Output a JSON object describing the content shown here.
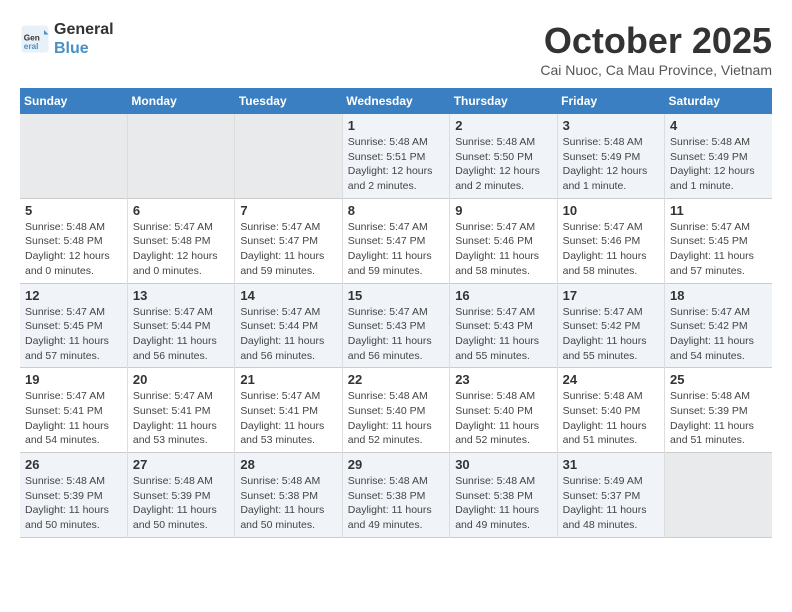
{
  "logo": {
    "line1": "General",
    "line2": "Blue"
  },
  "title": "October 2025",
  "location": "Cai Nuoc, Ca Mau Province, Vietnam",
  "days_of_week": [
    "Sunday",
    "Monday",
    "Tuesday",
    "Wednesday",
    "Thursday",
    "Friday",
    "Saturday"
  ],
  "weeks": [
    {
      "days": [
        {
          "number": "",
          "empty": true
        },
        {
          "number": "",
          "empty": true
        },
        {
          "number": "",
          "empty": true
        },
        {
          "number": "1",
          "sunrise": "5:48 AM",
          "sunset": "5:51 PM",
          "daylight": "12 hours and 2 minutes."
        },
        {
          "number": "2",
          "sunrise": "5:48 AM",
          "sunset": "5:50 PM",
          "daylight": "12 hours and 2 minutes."
        },
        {
          "number": "3",
          "sunrise": "5:48 AM",
          "sunset": "5:49 PM",
          "daylight": "12 hours and 1 minute."
        },
        {
          "number": "4",
          "sunrise": "5:48 AM",
          "sunset": "5:49 PM",
          "daylight": "12 hours and 1 minute."
        }
      ]
    },
    {
      "days": [
        {
          "number": "5",
          "sunrise": "5:48 AM",
          "sunset": "5:48 PM",
          "daylight": "12 hours and 0 minutes."
        },
        {
          "number": "6",
          "sunrise": "5:47 AM",
          "sunset": "5:48 PM",
          "daylight": "12 hours and 0 minutes."
        },
        {
          "number": "7",
          "sunrise": "5:47 AM",
          "sunset": "5:47 PM",
          "daylight": "11 hours and 59 minutes."
        },
        {
          "number": "8",
          "sunrise": "5:47 AM",
          "sunset": "5:47 PM",
          "daylight": "11 hours and 59 minutes."
        },
        {
          "number": "9",
          "sunrise": "5:47 AM",
          "sunset": "5:46 PM",
          "daylight": "11 hours and 58 minutes."
        },
        {
          "number": "10",
          "sunrise": "5:47 AM",
          "sunset": "5:46 PM",
          "daylight": "11 hours and 58 minutes."
        },
        {
          "number": "11",
          "sunrise": "5:47 AM",
          "sunset": "5:45 PM",
          "daylight": "11 hours and 57 minutes."
        }
      ]
    },
    {
      "days": [
        {
          "number": "12",
          "sunrise": "5:47 AM",
          "sunset": "5:45 PM",
          "daylight": "11 hours and 57 minutes."
        },
        {
          "number": "13",
          "sunrise": "5:47 AM",
          "sunset": "5:44 PM",
          "daylight": "11 hours and 56 minutes."
        },
        {
          "number": "14",
          "sunrise": "5:47 AM",
          "sunset": "5:44 PM",
          "daylight": "11 hours and 56 minutes."
        },
        {
          "number": "15",
          "sunrise": "5:47 AM",
          "sunset": "5:43 PM",
          "daylight": "11 hours and 56 minutes."
        },
        {
          "number": "16",
          "sunrise": "5:47 AM",
          "sunset": "5:43 PM",
          "daylight": "11 hours and 55 minutes."
        },
        {
          "number": "17",
          "sunrise": "5:47 AM",
          "sunset": "5:42 PM",
          "daylight": "11 hours and 55 minutes."
        },
        {
          "number": "18",
          "sunrise": "5:47 AM",
          "sunset": "5:42 PM",
          "daylight": "11 hours and 54 minutes."
        }
      ]
    },
    {
      "days": [
        {
          "number": "19",
          "sunrise": "5:47 AM",
          "sunset": "5:41 PM",
          "daylight": "11 hours and 54 minutes."
        },
        {
          "number": "20",
          "sunrise": "5:47 AM",
          "sunset": "5:41 PM",
          "daylight": "11 hours and 53 minutes."
        },
        {
          "number": "21",
          "sunrise": "5:47 AM",
          "sunset": "5:41 PM",
          "daylight": "11 hours and 53 minutes."
        },
        {
          "number": "22",
          "sunrise": "5:48 AM",
          "sunset": "5:40 PM",
          "daylight": "11 hours and 52 minutes."
        },
        {
          "number": "23",
          "sunrise": "5:48 AM",
          "sunset": "5:40 PM",
          "daylight": "11 hours and 52 minutes."
        },
        {
          "number": "24",
          "sunrise": "5:48 AM",
          "sunset": "5:40 PM",
          "daylight": "11 hours and 51 minutes."
        },
        {
          "number": "25",
          "sunrise": "5:48 AM",
          "sunset": "5:39 PM",
          "daylight": "11 hours and 51 minutes."
        }
      ]
    },
    {
      "days": [
        {
          "number": "26",
          "sunrise": "5:48 AM",
          "sunset": "5:39 PM",
          "daylight": "11 hours and 50 minutes."
        },
        {
          "number": "27",
          "sunrise": "5:48 AM",
          "sunset": "5:39 PM",
          "daylight": "11 hours and 50 minutes."
        },
        {
          "number": "28",
          "sunrise": "5:48 AM",
          "sunset": "5:38 PM",
          "daylight": "11 hours and 50 minutes."
        },
        {
          "number": "29",
          "sunrise": "5:48 AM",
          "sunset": "5:38 PM",
          "daylight": "11 hours and 49 minutes."
        },
        {
          "number": "30",
          "sunrise": "5:48 AM",
          "sunset": "5:38 PM",
          "daylight": "11 hours and 49 minutes."
        },
        {
          "number": "31",
          "sunrise": "5:49 AM",
          "sunset": "5:37 PM",
          "daylight": "11 hours and 48 minutes."
        },
        {
          "number": "",
          "empty": true
        }
      ]
    }
  ],
  "labels": {
    "sunrise": "Sunrise:",
    "sunset": "Sunset:",
    "daylight": "Daylight:"
  }
}
